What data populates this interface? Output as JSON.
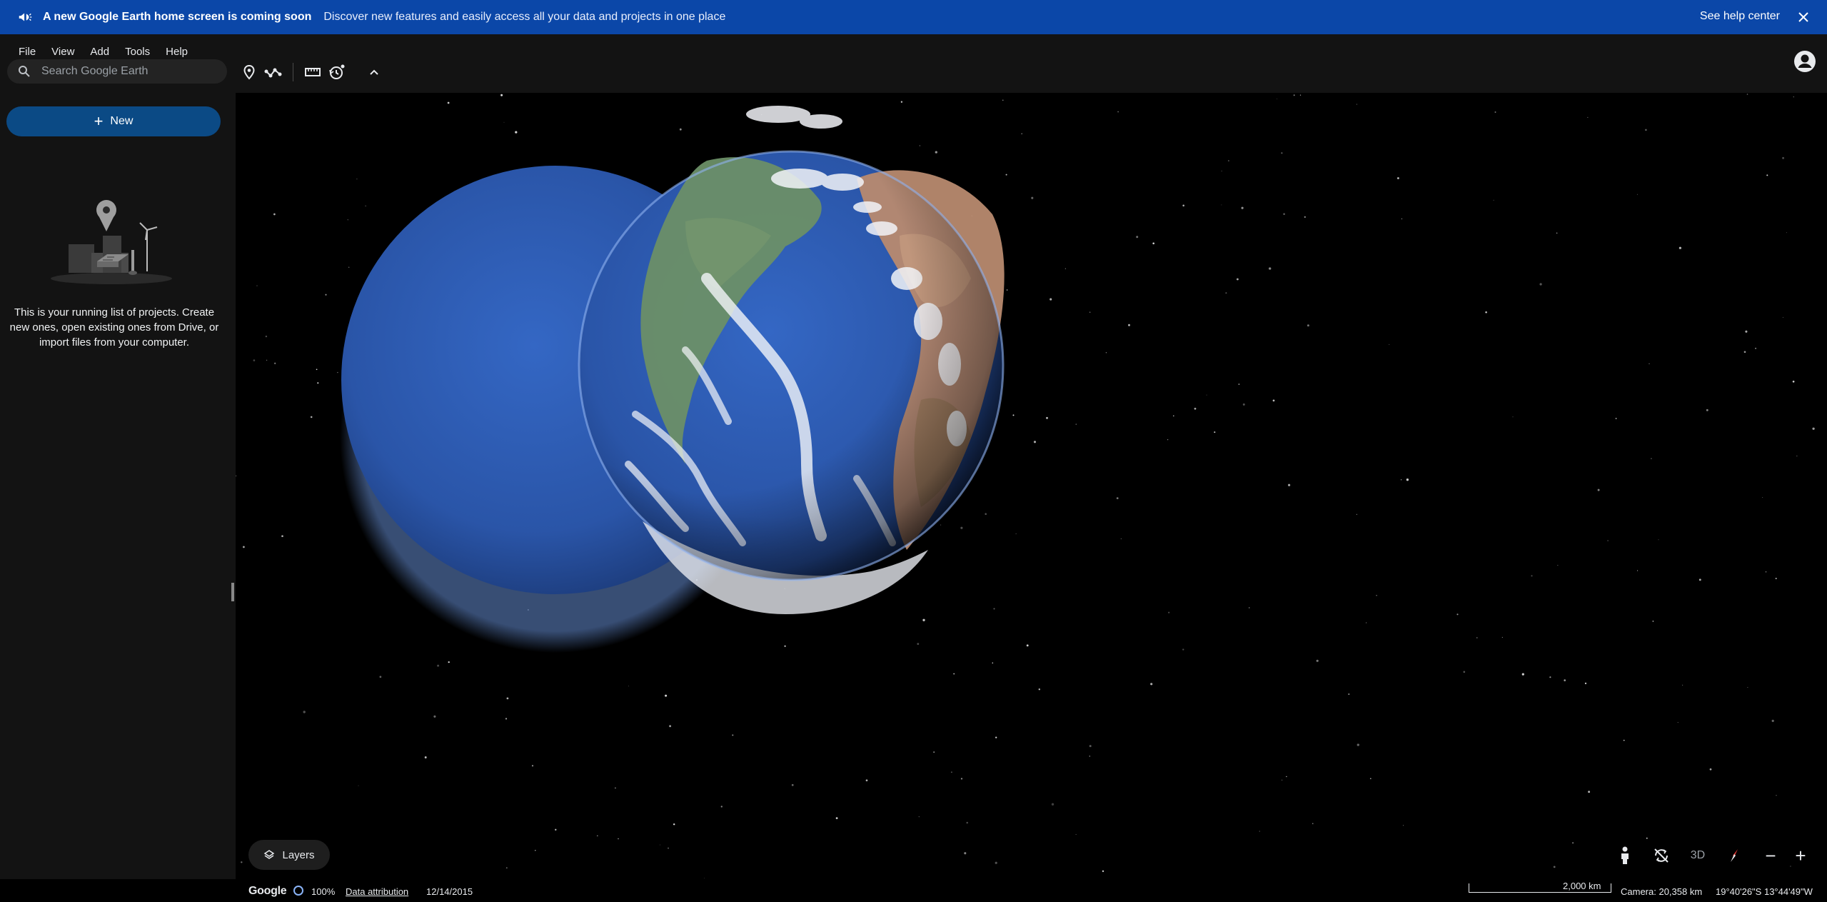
{
  "banner": {
    "icon": "megaphone-icon",
    "title": "A new Google Earth home screen is coming soon",
    "description": "Discover new features and easily access all your data and projects in one place",
    "help_link": "See help center",
    "close_icon": "close-icon"
  },
  "menu": {
    "items": [
      "File",
      "View",
      "Add",
      "Tools",
      "Help"
    ]
  },
  "search": {
    "placeholder": "Search Google Earth",
    "value": ""
  },
  "toolbar": {
    "icons": [
      "placemark-icon",
      "path-icon",
      "ruler-icon",
      "historical-imagery-icon",
      "chevron-up-icon"
    ]
  },
  "sidebar": {
    "new_button": "New",
    "empty_message": "This is your running list of projects. Create new ones, open existing ones from Drive, or import files from your computer."
  },
  "map_controls": {
    "layers_label": "Layers",
    "three_d_label": "3D",
    "zoom_out": "−",
    "zoom_in": "+"
  },
  "status": {
    "logo_text": "Google",
    "load_percent": "100%",
    "data_attribution": "Data attribution",
    "imagery_date": "12/14/2015",
    "scale_label": "2,000 km",
    "camera": "Camera: 20,358 km",
    "coordinates": "19°40'26\"S 13°44'49\"W"
  },
  "colors": {
    "banner_bg": "#0b47a8",
    "panel_bg": "#131313",
    "new_button_bg": "#0b4a85",
    "ocean": "#2f5fb8"
  }
}
